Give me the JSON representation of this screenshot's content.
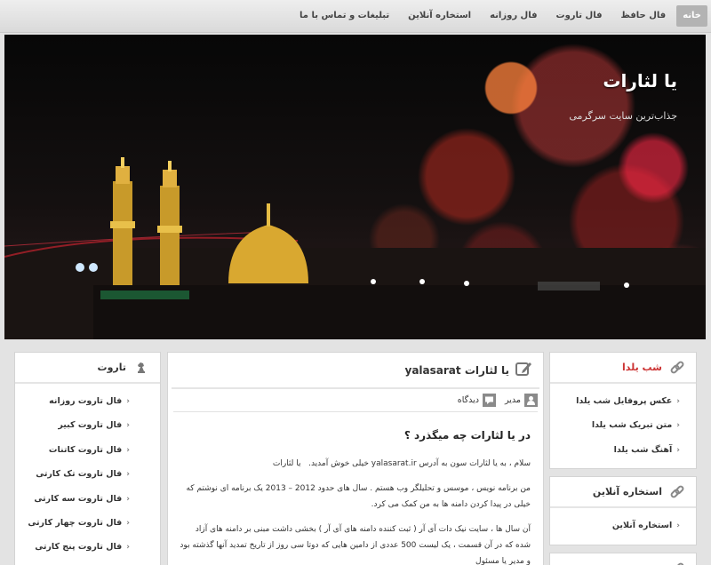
{
  "nav": {
    "items": [
      {
        "label": "خانه",
        "active": true
      },
      {
        "label": "فال حافظ"
      },
      {
        "label": "فال تاروت"
      },
      {
        "label": "فال روزانه"
      },
      {
        "label": "استخاره آنلاین"
      },
      {
        "label": "تبلیغات و تماس با ما"
      }
    ]
  },
  "header": {
    "site_title": "یا لثارات",
    "tagline": "جذاب‌ترین سایت سرگرمی"
  },
  "post": {
    "title": "یا لثارات yalasarat",
    "author": "مدیر",
    "comments_label": "دیدگاه",
    "heading": "در یا لثارات چه میگذرد ؟",
    "para1": "سلام ، به یا لثارات سون به آدرس yalasarat.ir خیلی خوش آمدید.",
    "para1_tail": "یا لثارات",
    "para2": "من برنامه نویس ، موسس و تحلیلگر وب هستم . سال های حدود 2012 – 2013 یک برنامه ای نوشتم که خیلی در پیدا کردن دامنه ها به من کمک می کرد.",
    "para3": "آن سال ها ، سایت نیک دات آی آر ( ثبت کننده دامنه های آی آر ) بخشی داشت مبنی بر دامنه های آزاد شده که در آن قسمت ، یک لیست 500 عددی از دامین هایی که دوتا سی روز از تاریخ تمدید آنها گذشته بود و مدیر یا مسئول"
  },
  "sidebar_left": {
    "title": "تاروت",
    "items": [
      "فال تاروت روزانه",
      "فال تاروت کبیر",
      "فال تاروت کاتنات",
      "فال تاروت تک کارتی",
      "فال تاروت سه کارتی",
      "فال تاروت چهار کارتی",
      "فال تاروت پنج کارتی"
    ]
  },
  "sidebar_right": {
    "yalda": {
      "title": "شب یلدا",
      "items": [
        "عکس پروفایل شب یلدا",
        "متن تبریک شب یلدا",
        "آهنگ شب یلدا"
      ]
    },
    "estekhare": {
      "title": "استخاره آنلاین",
      "items": [
        "استخاره آنلاین"
      ]
    }
  },
  "icons": {
    "widget": "link-icon",
    "tarot": "chess-knight-icon",
    "post": "edit-icon",
    "author": "user-icon",
    "comments": "comment-icon",
    "arrow": "chevron-left-icon"
  },
  "colors": {
    "accent_red": "#cc3333",
    "nav_active": "#b3b3b3"
  }
}
